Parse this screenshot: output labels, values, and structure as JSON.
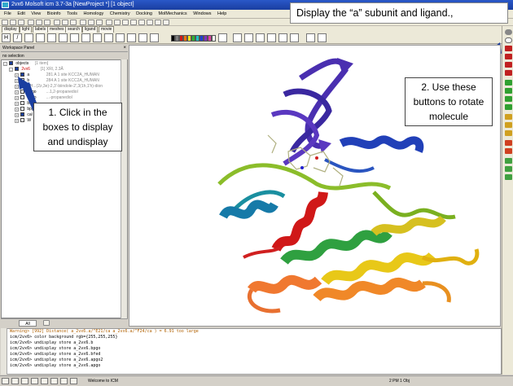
{
  "window": {
    "title": "2vx6 Molsoft icm 3.7-3a  [NewProject *] [1 object]"
  },
  "menu": [
    "File",
    "Edit",
    "View",
    "Bioinfo",
    "Tools",
    "Homology",
    "Chemistry",
    "Docking",
    "MolMechanics",
    "Windows",
    "Help"
  ],
  "tabs": [
    "display",
    "light",
    "labels",
    "meshes",
    "search",
    "ligand",
    "movie"
  ],
  "colors": {
    "title_bar": "#1a3ea0",
    "checked_box": "#1a3e9a",
    "helix_red": "#d01818",
    "sheet_violet": "#4a2fb0"
  },
  "callouts": {
    "top": "Display the “a” subunit and ligand.,",
    "one": "1. Click in the boxes to display and undisplay",
    "two": "2. Use these buttons to rotate molecule"
  },
  "workspace": {
    "title": "Workspace Panel",
    "selection": "no selection",
    "objects_label": "objects",
    "objects_count": "[1 item]",
    "rows": [
      {
        "name": "2vx6",
        "desc": "[1] XRl, 2.3Å",
        "checked": true,
        "red": true
      },
      {
        "name": "a",
        "desc": "281 A 1 site KCC2A_HUMAN",
        "checked": true
      },
      {
        "name": "b",
        "desc": "284 A 1 site KCC2A_HUMAN",
        "checked": false
      },
      {
        "name": "",
        "desc": "H...(2z,3e)-2,3'-biindole-2',3(1h,1'h)-dion",
        "checked": false
      },
      {
        "name": "apgo",
        "desc": "...1,2-propanediol",
        "checked": false
      },
      {
        "name": "apgo",
        "desc": "...-propanediol",
        "checked": false
      },
      {
        "name": "bfed",
        "desc": "",
        "checked": false
      },
      {
        "name": "bpgo",
        "desc": "",
        "checked": false
      },
      {
        "name": "cal",
        "desc": "",
        "checked": true
      },
      {
        "name": "W",
        "desc": "",
        "checked": false
      }
    ],
    "bottom_tab": "All"
  },
  "console": {
    "lines": [
      {
        "text": "Warning> [992] Distance( a_2vx6.a/^E21/ca a_2vx6.a/^F24/ca ) =   6.91 too large",
        "warn": true
      },
      {
        "text": "icm/2vx6> color background rgb={255,255,255}",
        "warn": false
      },
      {
        "text": "icm/2vx6> undisplay store a_2vx6.b",
        "warn": false
      },
      {
        "text": "icm/2vx6> undisplay store a_2vx6.bpgo",
        "warn": false
      },
      {
        "text": "icm/2vx6> undisplay store a_2vx6.bfed",
        "warn": false
      },
      {
        "text": "icm/2vx6> undisplay store a_2vx6.apgo2",
        "warn": false
      },
      {
        "text": "icm/2vx6> undisplay store a_2vx6.apgo",
        "warn": false
      }
    ]
  },
  "status": {
    "message": "Welcome to ICM",
    "right": "2 PM  1 Obj"
  }
}
